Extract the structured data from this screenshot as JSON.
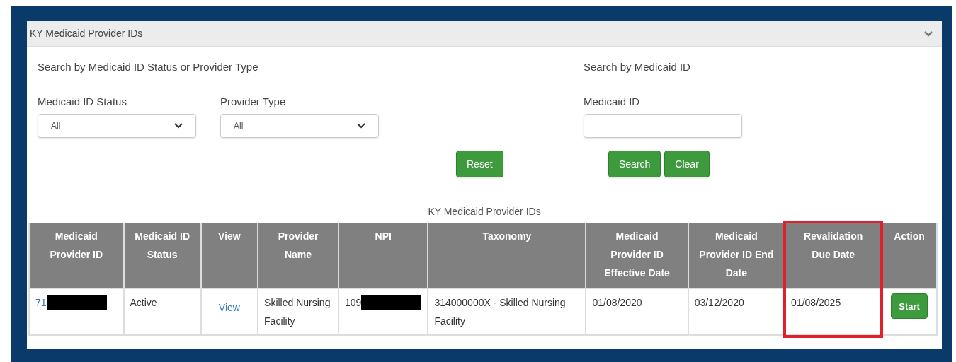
{
  "panel": {
    "title": "KY Medicaid Provider IDs",
    "expanded": true
  },
  "filter_group": {
    "heading": "Search by Medicaid ID Status or Provider Type",
    "selects": [
      {
        "label": "Medicaid ID Status",
        "value": "All"
      },
      {
        "label": "Provider Type",
        "value": "All"
      }
    ],
    "buttons": [
      "Reset"
    ]
  },
  "id_group": {
    "heading": "Search by Medicaid ID",
    "field_label": "Medicaid ID",
    "buttons": [
      "Search",
      "Clear"
    ]
  },
  "table": {
    "caption": "KY Medicaid Provider IDs",
    "columns": [
      {
        "label": "Medicaid Provider ID",
        "highlighted": false
      },
      {
        "label": "Medicaid ID Status",
        "highlighted": false
      },
      {
        "label": "View",
        "highlighted": false
      },
      {
        "label": "Provider Name",
        "highlighted": false
      },
      {
        "label": "NPI",
        "highlighted": false
      },
      {
        "label": "Taxonomy",
        "highlighted": false
      },
      {
        "label": "Medicaid Provider ID Effective Date",
        "highlighted": false
      },
      {
        "label": "Medicaid Provider ID End Date",
        "highlighted": false
      },
      {
        "label": "Revalidation Due Date",
        "highlighted": true
      },
      {
        "label": "Action",
        "highlighted": false
      }
    ],
    "rows": [
      {
        "provider_id": "71",
        "provider_id_redacted": true,
        "status": "Active",
        "view": "View",
        "provider_name": "Skilled Nursing Facility",
        "npi": "109",
        "npi_redacted": true,
        "taxonomy": "314000000X - Skilled Nursing Facility",
        "effective_date": "01/08/2020",
        "end_date": "03/12/2020",
        "revalidation_due_date": "01/08/2025",
        "action": "Start"
      }
    ]
  }
}
